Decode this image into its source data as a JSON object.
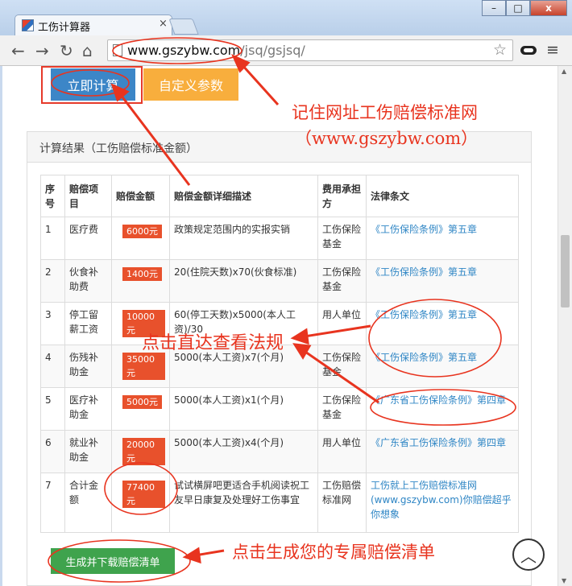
{
  "window": {
    "tab_title": "工伤计算器",
    "tab_close": "×",
    "minimize": "–",
    "maximize": "□",
    "close": "x"
  },
  "toolbar": {
    "back": "←",
    "forward": "→",
    "reload": "↻",
    "home": "⌂",
    "url_domain": "www.gszybw.com",
    "url_path": "/jsq/gsjsq/",
    "star": "☆",
    "menu": "≡"
  },
  "buttons": {
    "calc": "立即计算",
    "custom": "自定义参数",
    "generate": "生成并下载赔偿清单",
    "back_to_top": "︿"
  },
  "panel": {
    "title": "计算结果（工伤赔偿标准金额）"
  },
  "table": {
    "headers": [
      "序号",
      "赔偿项目",
      "赔偿金额",
      "赔偿金额详细描述",
      "费用承担方",
      "法律条文"
    ],
    "rows": [
      {
        "no": "1",
        "item": "医疗费",
        "amount": "6000元",
        "desc": "政策规定范围内的实报实销",
        "payer": "工伤保险基金",
        "law": "《工伤保险条例》第五章"
      },
      {
        "no": "2",
        "item": "伙食补助费",
        "amount": "1400元",
        "desc": "20(住院天数)x70(伙食标准)",
        "payer": "工伤保险基金",
        "law": "《工伤保险条例》第五章"
      },
      {
        "no": "3",
        "item": "停工留薪工资",
        "amount": "10000元",
        "desc": "60(停工天数)x5000(本人工资)/30",
        "payer": "用人单位",
        "law": "《工伤保险条例》第五章"
      },
      {
        "no": "4",
        "item": "伤残补助金",
        "amount": "35000元",
        "desc": "5000(本人工资)x7(个月)",
        "payer": "工伤保险基金",
        "law": "《工伤保险条例》第五章"
      },
      {
        "no": "5",
        "item": "医疗补助金",
        "amount": "5000元",
        "desc": "5000(本人工资)x1(个月)",
        "payer": "工伤保险基金",
        "law": "《广东省工伤保险条例》第四章"
      },
      {
        "no": "6",
        "item": "就业补助金",
        "amount": "20000元",
        "desc": "5000(本人工资)x4(个月)",
        "payer": "用人单位",
        "law": "《广东省工伤保险条例》第四章"
      },
      {
        "no": "7",
        "item": "合计金额",
        "amount": "77400元",
        "desc": "试试横屏吧更适合手机阅读祝工友早日康复及处理好工伤事宜",
        "payer": "工伤赔偿标准网",
        "law": "工伤就上工伤赔偿标准网(www.gszybw.com)你赔偿超乎你想象"
      }
    ]
  },
  "annotations": {
    "remember": "记住网址工伤赔偿标准网",
    "site": "（www.gszybw.com）",
    "click_law": "点击直达查看法规",
    "click_generate": "点击生成您的专属赔偿清单"
  },
  "colors": {
    "annotation": "#e8341f",
    "calc_button": "#3c86c7",
    "custom_button": "#f8ae3d",
    "generate_button": "#3fa34d",
    "amount_badge": "#e8512c",
    "law_link": "#2f86c5"
  }
}
